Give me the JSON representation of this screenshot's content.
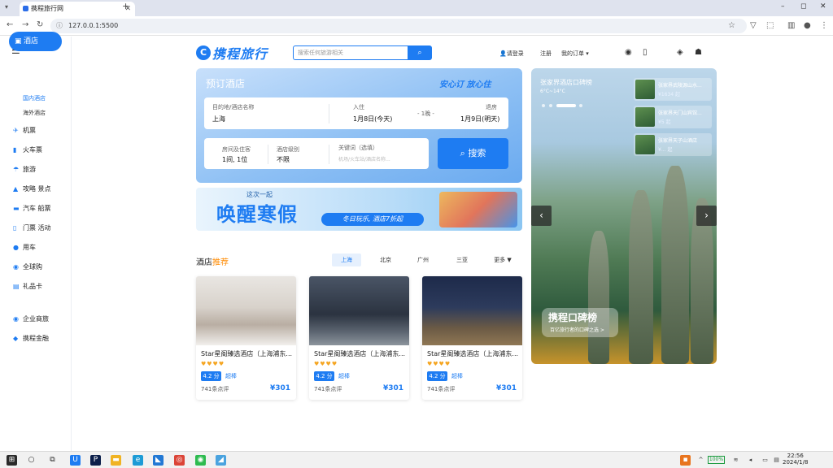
{
  "browser": {
    "tab_title": "携程旅行网",
    "new_tab": "+",
    "url": "127.0.0.1:5500",
    "win_min": "–",
    "win_max": "◻",
    "win_close": "✕",
    "tab_close": "✕"
  },
  "sidebar": {
    "hotel": "酒店",
    "sub_items": [
      "国内酒店",
      "海外酒店"
    ],
    "items": [
      "机票",
      "火车票",
      "旅游",
      "攻略 景点",
      "汽车 船票",
      "门票 活动",
      "用车",
      "全球购",
      "礼品卡",
      "企业商旅",
      "携程金融"
    ]
  },
  "header": {
    "logo_text": "携程旅行",
    "search_placeholder": "搜索任何旅游相关",
    "login": "请登录",
    "register": "注册",
    "orders": "我的订单 ▾"
  },
  "booking": {
    "title": "预订酒店",
    "slogan": "安心订 放心住",
    "dest_label": "目的地/酒店名称",
    "dest_value": "上海",
    "checkin_label": "入住",
    "checkin_value": "1月8日(今天)",
    "nights": "- 1晚 -",
    "checkout_label": "退房",
    "checkout_value": "1月9日(明天)",
    "rooms_label": "房间及住客",
    "rooms_value": "1间, 1位",
    "level_label": "酒店级别",
    "level_value": "不限",
    "keyword_label": "关键词（选填）",
    "keyword_placeholder": "机场/火车站/酒店名称...",
    "search_button": "搜索"
  },
  "banner": {
    "small": "这次一起",
    "big": "唤醒寒假",
    "promo": "冬日玩乐, 酒店7折起"
  },
  "recommend": {
    "title_a": "酒店",
    "title_b": "推荐",
    "cities": [
      "上海",
      "北京",
      "广州",
      "三亚",
      "更多 ▼"
    ],
    "hotels": [
      {
        "name": "Star星阁臻选酒店（上海浦东...",
        "stars": "♥♥♥♥",
        "score": "4.2 分",
        "tag": "超棒",
        "reviews": "741条点评",
        "price": "¥301"
      },
      {
        "name": "Star星阁臻选酒店（上海浦东...",
        "stars": "♥♥♥♥",
        "score": "4.2 分",
        "tag": "超棒",
        "reviews": "741条点评",
        "price": "¥301"
      },
      {
        "name": "Star星阁臻选酒店（上海浦东...",
        "stars": "♥♥♥♥",
        "score": "4.2 分",
        "tag": "超棒",
        "reviews": "741条点评",
        "price": "¥301"
      }
    ]
  },
  "scenery": {
    "title": "张家界酒店口碑榜",
    "weather": "6°C~14°C",
    "thumbs": [
      {
        "title": "张家界武陵源山水...",
        "sub": "¥1634 起"
      },
      {
        "title": "张家界天门山宾馆...",
        "sub": "¥5 起"
      },
      {
        "title": "张家界天子山酒店",
        "sub": "¥... 起"
      }
    ],
    "prev": "‹",
    "next": "›",
    "koubei_title": "携程口碑榜",
    "koubei_sub": "百亿旅行者的口碑之选 >"
  },
  "taskbar": {
    "battery": "100%",
    "time": "22:56",
    "date": "2024/1/8"
  }
}
